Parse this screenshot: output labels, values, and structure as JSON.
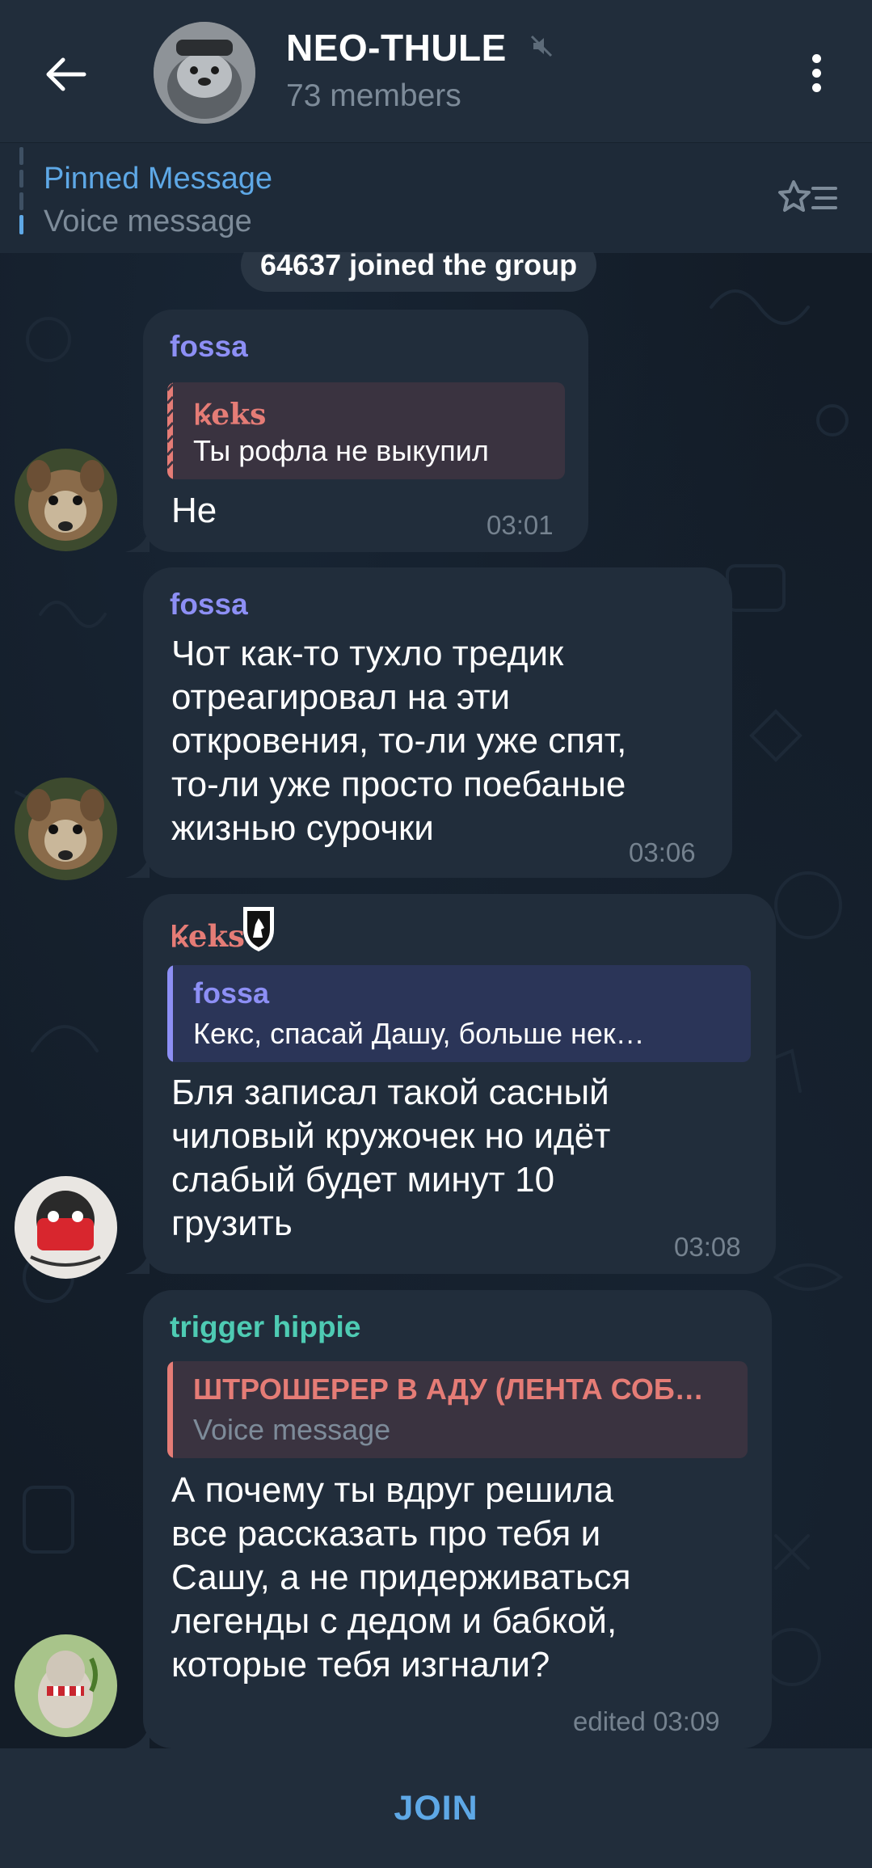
{
  "header": {
    "title": "NEO-THULE",
    "members": "73 members"
  },
  "pinned": {
    "title": "Pinned Message",
    "subtitle": "Voice message"
  },
  "service_message": "64637 joined the group",
  "messages": [
    {
      "sender": "fossa",
      "sender_color": "#8d8ff5",
      "reply_name": "Ꝃeks",
      "reply_text": "Ты рофла не выкупил",
      "reply_color": "#e57c76",
      "text": "Не",
      "time": "03:01"
    },
    {
      "sender": "fossa",
      "sender_color": "#8d8ff5",
      "text_lines": [
        "Чот как-то тухло тредик",
        "отреагировал на эти",
        "откровения, то-ли уже спят,",
        "то-ли уже просто поебаные",
        "жизнью сурочки"
      ],
      "time": "03:06"
    },
    {
      "sender": "Ꝃeks",
      "sender_color": "#e57c76",
      "reply_name": "fossa",
      "reply_text": "Кекс, спасай Дашу, больше нек…",
      "reply_color": "#8d8ff5",
      "text_lines": [
        "Бля записал такой сасный",
        "чиловый кружочек но идёт",
        "слабый будет минут 10",
        "грузить"
      ],
      "time": "03:08"
    },
    {
      "sender": "trigger hippie",
      "sender_color": "#4ecbb3",
      "reply_name": "ШТРОШЕРЕР В АДУ (ЛЕНТА СОБ…",
      "reply_text": "Voice message",
      "reply_color": "#e57c76",
      "text_lines": [
        "А почему ты вдруг решила",
        "все рассказать про тебя и",
        "Сашу, а не придерживаться",
        "легенды с дедом и бабкой,",
        "которые тебя изгнали?"
      ],
      "time": "edited 03:09"
    }
  ],
  "join_label": "JOIN",
  "colors": {
    "background": "#131c27",
    "bar": "#212d3b",
    "bubble": "#212d3b",
    "accent": "#5ea8e6",
    "meta": "#75828f"
  }
}
